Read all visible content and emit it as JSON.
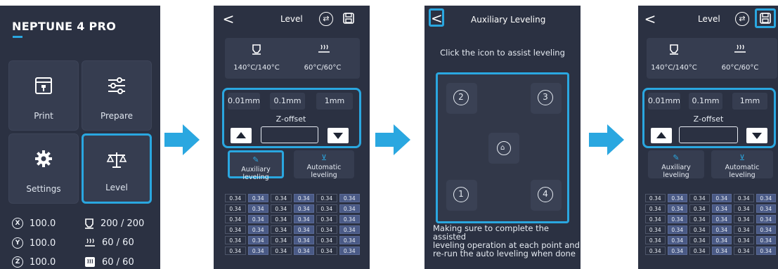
{
  "colors": {
    "panel_bg": "#2b3142",
    "tile_bg": "#363d50",
    "accent": "#2aa7e0",
    "grid_alt": "#4a5a86"
  },
  "home": {
    "brand": "NEPTUNE 4 PRO",
    "tiles": [
      {
        "label": "Print",
        "icon": "print-icon"
      },
      {
        "label": "Prepare",
        "icon": "sliders-icon"
      },
      {
        "label": "Settings",
        "icon": "gear-icon"
      },
      {
        "label": "Level",
        "icon": "scale-icon",
        "highlighted": true
      }
    ],
    "stats": {
      "x": {
        "axis": "X",
        "value": "100.0"
      },
      "y": {
        "axis": "Y",
        "value": "100.0"
      },
      "z": {
        "axis": "Z",
        "value": "100.0"
      },
      "nozzle": "200 / 200",
      "bed": "60 / 60",
      "chamber": "60 / 60"
    }
  },
  "level": {
    "title": "Level",
    "back": "<",
    "nozzle_temp": "140°C/140°C",
    "bed_temp": "60°C/60°C",
    "steps": [
      "0.01mm",
      "0.1mm",
      "1mm"
    ],
    "zoffset_label": "Z-offset",
    "zoffset_value": "",
    "aux_label": "Auxiliary leveling",
    "auto_label": "Automatic leveling",
    "mesh": [
      [
        "0.34",
        "0.34",
        "0.34",
        "0.34",
        "0.34",
        "0.34"
      ],
      [
        "0.34",
        "0.34",
        "0.34",
        "0.34",
        "0.34",
        "0.34"
      ],
      [
        "0.34",
        "0.34",
        "0.34",
        "0.34",
        "0.34",
        "0.34"
      ],
      [
        "0.34",
        "0.34",
        "0.34",
        "0.34",
        "0.34",
        "0.34"
      ],
      [
        "0.34",
        "0.34",
        "0.34",
        "0.34",
        "0.34",
        "0.34"
      ],
      [
        "0.34",
        "0.34",
        "0.34",
        "0.34",
        "0.34",
        "0.34"
      ]
    ]
  },
  "aux": {
    "back": "<",
    "title": "Auxiliary Leveling",
    "hint": "Click the icon to assist leveling",
    "points": [
      "2",
      "3",
      "1",
      "4"
    ],
    "note_1": "Making sure to complete the assisted",
    "note_2": "leveling operation at each point and",
    "note_3": "re-run the auto leveling when done"
  }
}
